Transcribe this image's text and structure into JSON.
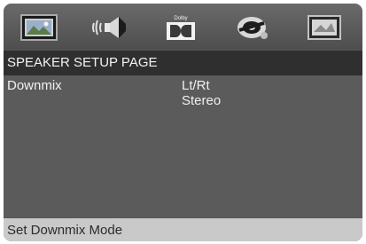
{
  "tabs": [
    {
      "id": "general",
      "icon": "picture-frame-icon"
    },
    {
      "id": "audio",
      "icon": "speaker-icon"
    },
    {
      "id": "dolby",
      "icon": "dolby-icon",
      "text": "Dolby"
    },
    {
      "id": "preference",
      "icon": "disc-preference-icon"
    },
    {
      "id": "password",
      "icon": "framed-picture-icon"
    }
  ],
  "page": {
    "title": "SPEAKER SETUP PAGE"
  },
  "setting": {
    "label": "Downmix",
    "options": [
      "Lt/Rt",
      "Stereo"
    ]
  },
  "status": {
    "text": "Set Downmix Mode"
  }
}
